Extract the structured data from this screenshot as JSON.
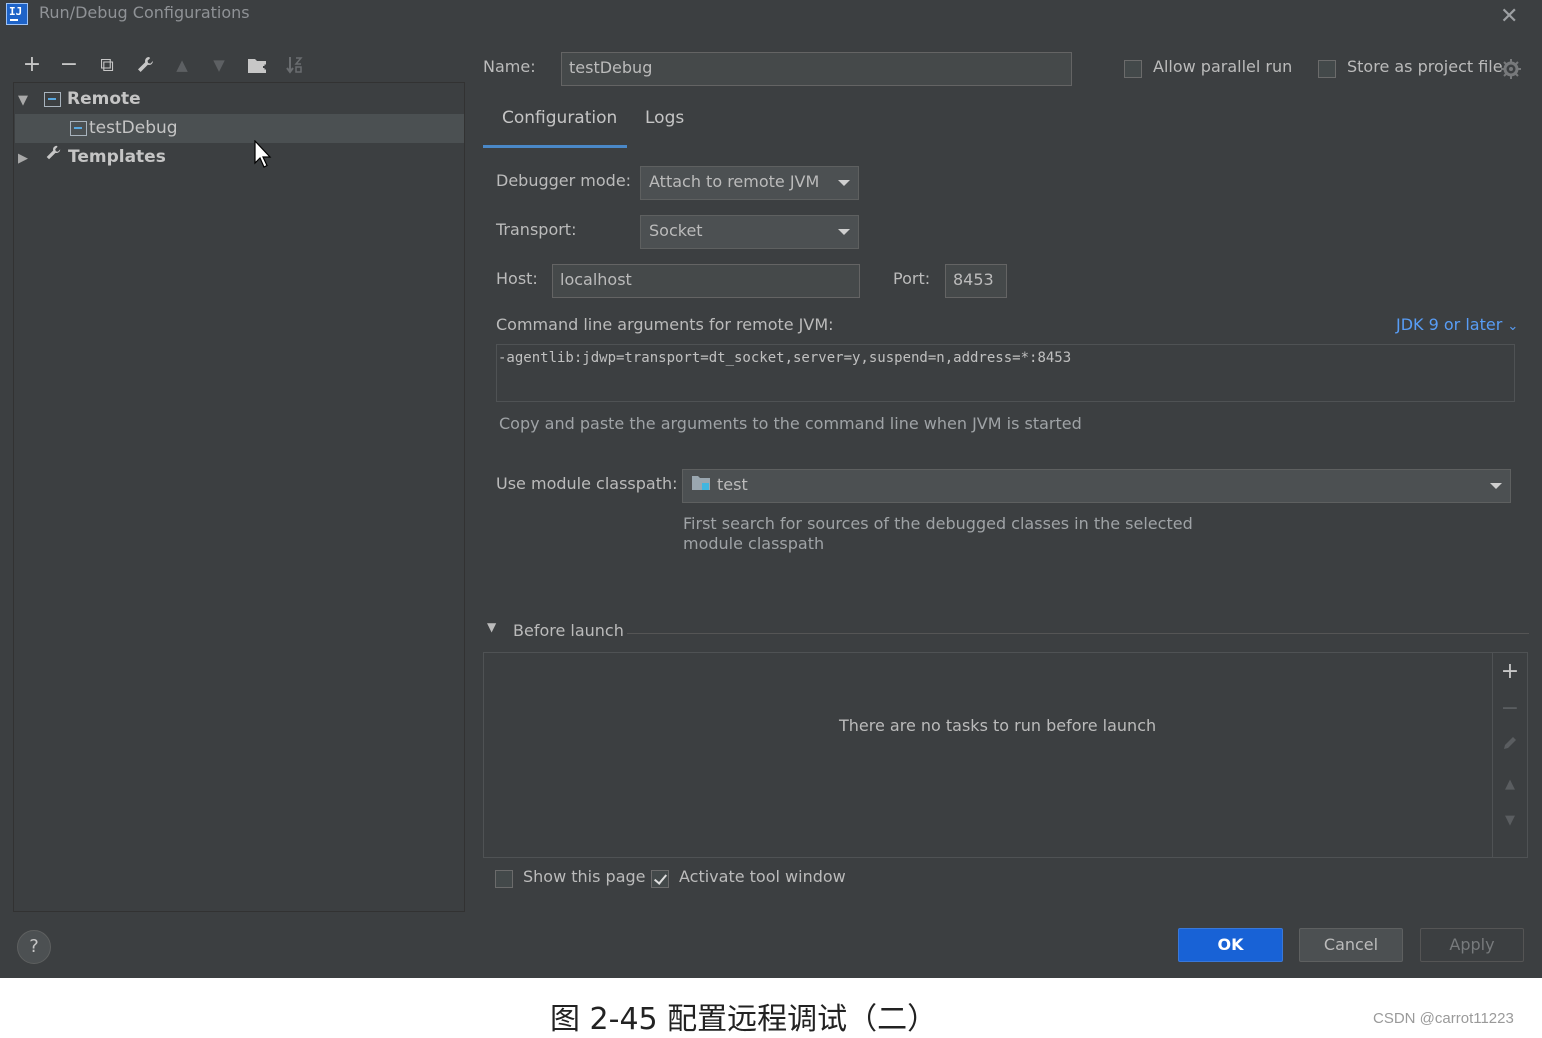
{
  "window": {
    "title": "Run/Debug Configurations",
    "app_logo_text": "IJ"
  },
  "toolbar": {
    "add": "+",
    "remove": "−",
    "copy": "⧉",
    "edit": "🔧",
    "move_up": "▲",
    "move_down": "▼",
    "new_folder": "📁",
    "sort": "↓"
  },
  "tree": {
    "remote_group": "Remote",
    "selected_item": "testDebug",
    "templates": "Templates"
  },
  "header": {
    "name_label": "Name:",
    "name_value": "testDebug",
    "allow_parallel": "Allow parallel run",
    "store_as_project": "Store as project file"
  },
  "tabs": [
    {
      "label": "Configuration",
      "active": true
    },
    {
      "label": "Logs",
      "active": false
    }
  ],
  "config": {
    "debugger_mode_label": "Debugger mode:",
    "debugger_mode_value": "Attach to remote JVM",
    "transport_label": "Transport:",
    "transport_value": "Socket",
    "host_label": "Host:",
    "host_value": "localhost",
    "port_label": "Port:",
    "port_value": "8453",
    "cmd_args_label": "Command line arguments for remote JVM:",
    "jdk_link": "JDK 9 or later",
    "cmd_args_value": "-agentlib:jdwp=transport=dt_socket,server=y,suspend=n,address=*:8453",
    "cmd_args_hint": "Copy and paste the arguments to the command line when JVM is started",
    "module_classpath_label": "Use module classpath:",
    "module_classpath_value": "test",
    "module_hint_line1": "First search for sources of the debugged classes in the selected",
    "module_hint_line2": "module classpath"
  },
  "before_launch": {
    "title": "Before launch",
    "empty_text": "There are no tasks to run before launch"
  },
  "options": {
    "show_this_page": "Show this page",
    "show_this_page_checked": false,
    "activate_tool_window": "Activate tool window",
    "activate_tool_window_checked": true
  },
  "buttons": {
    "ok": "OK",
    "cancel": "Cancel",
    "apply": "Apply",
    "help": "?"
  },
  "caption": "图 2-45 配置远程调试（二）",
  "watermark": "CSDN @carrot11223",
  "colors": {
    "background": "#3c3f41",
    "selection": "#4b5052",
    "accent": "#4a88c7",
    "link": "#589df6",
    "primary_button": "#1862d6"
  }
}
